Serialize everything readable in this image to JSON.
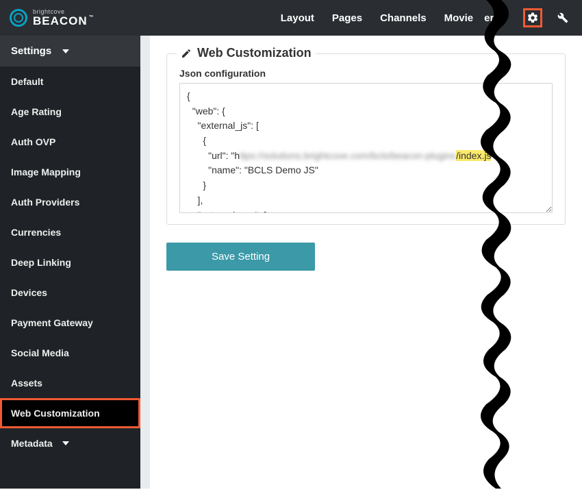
{
  "brand": {
    "small": "brightcove",
    "big": "BEACON",
    "tm": "™"
  },
  "topnav": {
    "items": [
      "Layout",
      "Pages",
      "Channels",
      "Movie",
      "erce"
    ]
  },
  "sidebar": {
    "header": "Settings",
    "items": [
      {
        "label": "Default"
      },
      {
        "label": "Age Rating"
      },
      {
        "label": "Auth OVP"
      },
      {
        "label": "Image Mapping"
      },
      {
        "label": "Auth Providers"
      },
      {
        "label": "Currencies"
      },
      {
        "label": "Deep Linking"
      },
      {
        "label": "Devices"
      },
      {
        "label": "Payment Gateway"
      },
      {
        "label": "Social Media"
      },
      {
        "label": "Assets"
      },
      {
        "label": "Web Customization",
        "active": true,
        "highlighted": true
      },
      {
        "label": "Metadata",
        "caret": true
      }
    ]
  },
  "panel": {
    "title": "Web Customization",
    "fieldLabel": "Json configuration",
    "json": {
      "l1": "{",
      "l2": "  \"web\": {",
      "l3": "    \"external_js\": [",
      "l4": "      {",
      "l5a": "        \"url\": \"h",
      "l5b_blur": "ttps://solutions.brightcove.com/bcls/beacon-plugins",
      "l5c_hl": "/index.js",
      "l5d": "\",",
      "l6": "        \"name\": \"BCLS Demo JS\"",
      "l7": "      }",
      "l8": "    ],",
      "l9": "    \"external_css\": [",
      "l10": "      {"
    }
  },
  "actions": {
    "save": "Save Setting"
  }
}
